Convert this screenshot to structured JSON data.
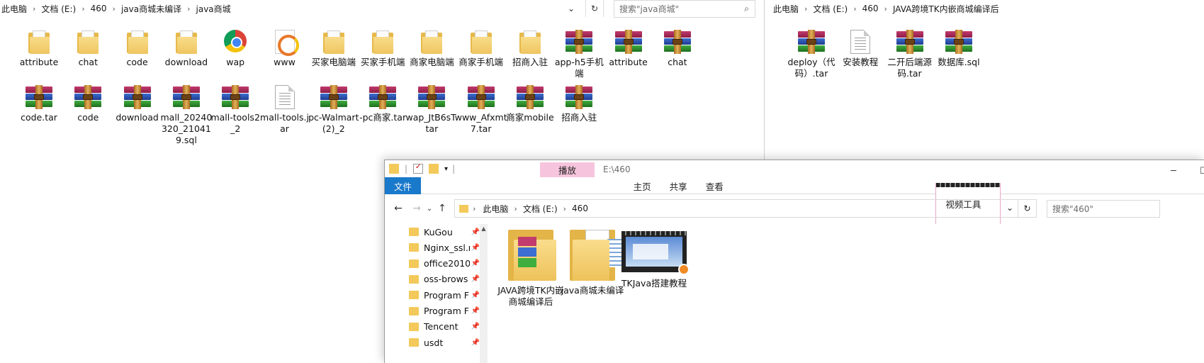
{
  "window1": {
    "breadcrumb": [
      "此电脑",
      "文档 (E:)",
      "460",
      "java商城未编译",
      "java商城"
    ],
    "search_placeholder": "搜索\"java商城\"",
    "row1": [
      {
        "label": "attribute",
        "icon": "folder-icon"
      },
      {
        "label": "chat",
        "icon": "folder-icon"
      },
      {
        "label": "code",
        "icon": "folder-icon"
      },
      {
        "label": "download",
        "icon": "folder-icon"
      },
      {
        "label": "wap",
        "icon": "chrome-icon"
      },
      {
        "label": "www",
        "icon": "www-icon"
      },
      {
        "label": "买家电脑端",
        "icon": "folder-icon"
      },
      {
        "label": "买家手机端",
        "icon": "folder-icon"
      },
      {
        "label": "商家电脑端",
        "icon": "folder-icon"
      },
      {
        "label": "商家手机端",
        "icon": "folder-icon"
      },
      {
        "label": "招商入驻",
        "icon": "folder-icon"
      },
      {
        "label": "app-h5手机端",
        "icon": "rar-icon"
      },
      {
        "label": "attribute",
        "icon": "rar-icon"
      },
      {
        "label": "chat",
        "icon": "rar-icon"
      }
    ],
    "row2": [
      {
        "label": "code.tar",
        "icon": "rar-icon"
      },
      {
        "label": "code",
        "icon": "rar-icon"
      },
      {
        "label": "download",
        "icon": "rar-icon"
      },
      {
        "label": "mall_20240320_210419.sql",
        "icon": "rar-icon"
      },
      {
        "label": "mall-tools2_2",
        "icon": "rar-icon"
      },
      {
        "label": "mall-tools.jar",
        "icon": "file-icon"
      },
      {
        "label": "pc-Walmart (2)_2",
        "icon": "rar-icon"
      },
      {
        "label": "-pc商家.tar",
        "icon": "rar-icon"
      },
      {
        "label": "wap_JtB6sT.tar",
        "icon": "rar-icon"
      },
      {
        "label": "www_Afxmt7.tar",
        "icon": "rar-icon"
      },
      {
        "label": "商家mobile",
        "icon": "rar-icon"
      },
      {
        "label": "招商入驻",
        "icon": "rar-icon"
      }
    ]
  },
  "window2": {
    "breadcrumb": [
      "此电脑",
      "文档 (E:)",
      "460",
      "JAVA跨境TK内嵌商城编译后"
    ],
    "items": [
      {
        "label": "deploy（代码）.tar",
        "icon": "rar-icon"
      },
      {
        "label": "安装教程",
        "icon": "file-icon"
      },
      {
        "label": "二开后端源码.tar",
        "icon": "rar-icon"
      },
      {
        "label": "数据库.sql",
        "icon": "rar-icon"
      }
    ]
  },
  "window3": {
    "title": "E:\\460",
    "context_tab_header": "播放",
    "tabs": [
      "文件",
      "主页",
      "共享",
      "查看",
      "视频工具"
    ],
    "breadcrumb": [
      "此电脑",
      "文档 (E:)",
      "460"
    ],
    "search_placeholder": "搜索\"460\"",
    "sidebar": [
      "KuGou",
      "Nginx_ssl.r",
      "office2010",
      "oss-brows",
      "Program F",
      "Program F",
      "Tencent",
      "usdt"
    ],
    "items": [
      {
        "label": "JAVA跨境TK内嵌商城编译后",
        "icon": "zip-folder-icon"
      },
      {
        "label": "java商城未编译",
        "icon": "folder-icon"
      },
      {
        "label": "TKJava搭建教程",
        "icon": "video-icon"
      }
    ]
  }
}
